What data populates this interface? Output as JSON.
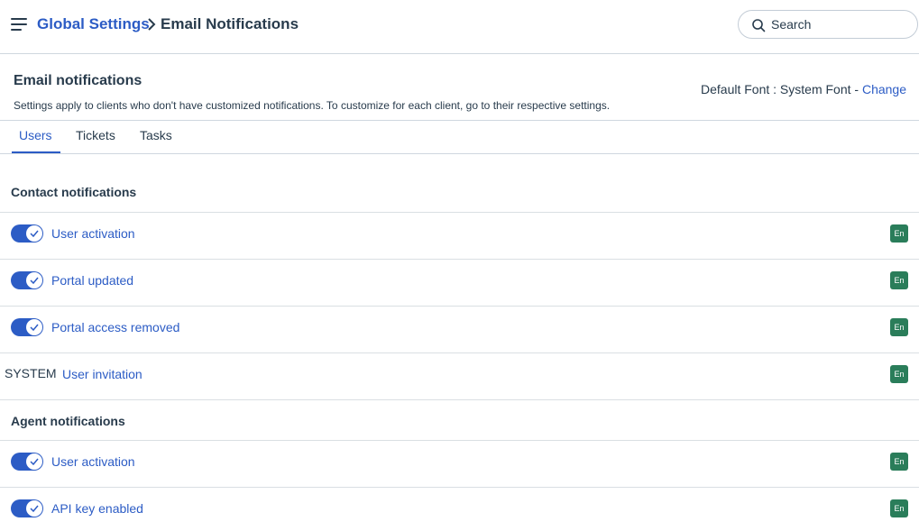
{
  "header": {
    "breadcrumb_root": "Global Settings",
    "breadcrumb_current": "Email Notifications",
    "search_placeholder": "Search"
  },
  "page": {
    "title": "Email notifications",
    "subtitle": "Settings apply to clients who don't have customized notifications. To customize for each client, go to their respective settings.",
    "font_label": "Default Font : System Font - ",
    "font_change": "Change"
  },
  "tabs": [
    {
      "label": "Users",
      "active": true
    },
    {
      "label": "Tickets",
      "active": false
    },
    {
      "label": "Tasks",
      "active": false
    }
  ],
  "sections": [
    {
      "title": "Contact notifications",
      "items": [
        {
          "label": "User activation",
          "enabled": true,
          "lang": "En"
        },
        {
          "label": "Portal updated",
          "enabled": true,
          "lang": "En"
        },
        {
          "label": "Portal access removed",
          "enabled": true,
          "lang": "En"
        },
        {
          "label": "User invitation",
          "system": "SYSTEM",
          "lang": "En"
        }
      ]
    },
    {
      "title": "Agent notifications",
      "items": [
        {
          "label": "User activation",
          "enabled": true,
          "lang": "En"
        },
        {
          "label": "API key enabled",
          "enabled": true,
          "lang": "En"
        }
      ]
    }
  ],
  "colors": {
    "accent": "#2c5cc5",
    "badge": "#2a7d5a",
    "text": "#283b4c"
  }
}
